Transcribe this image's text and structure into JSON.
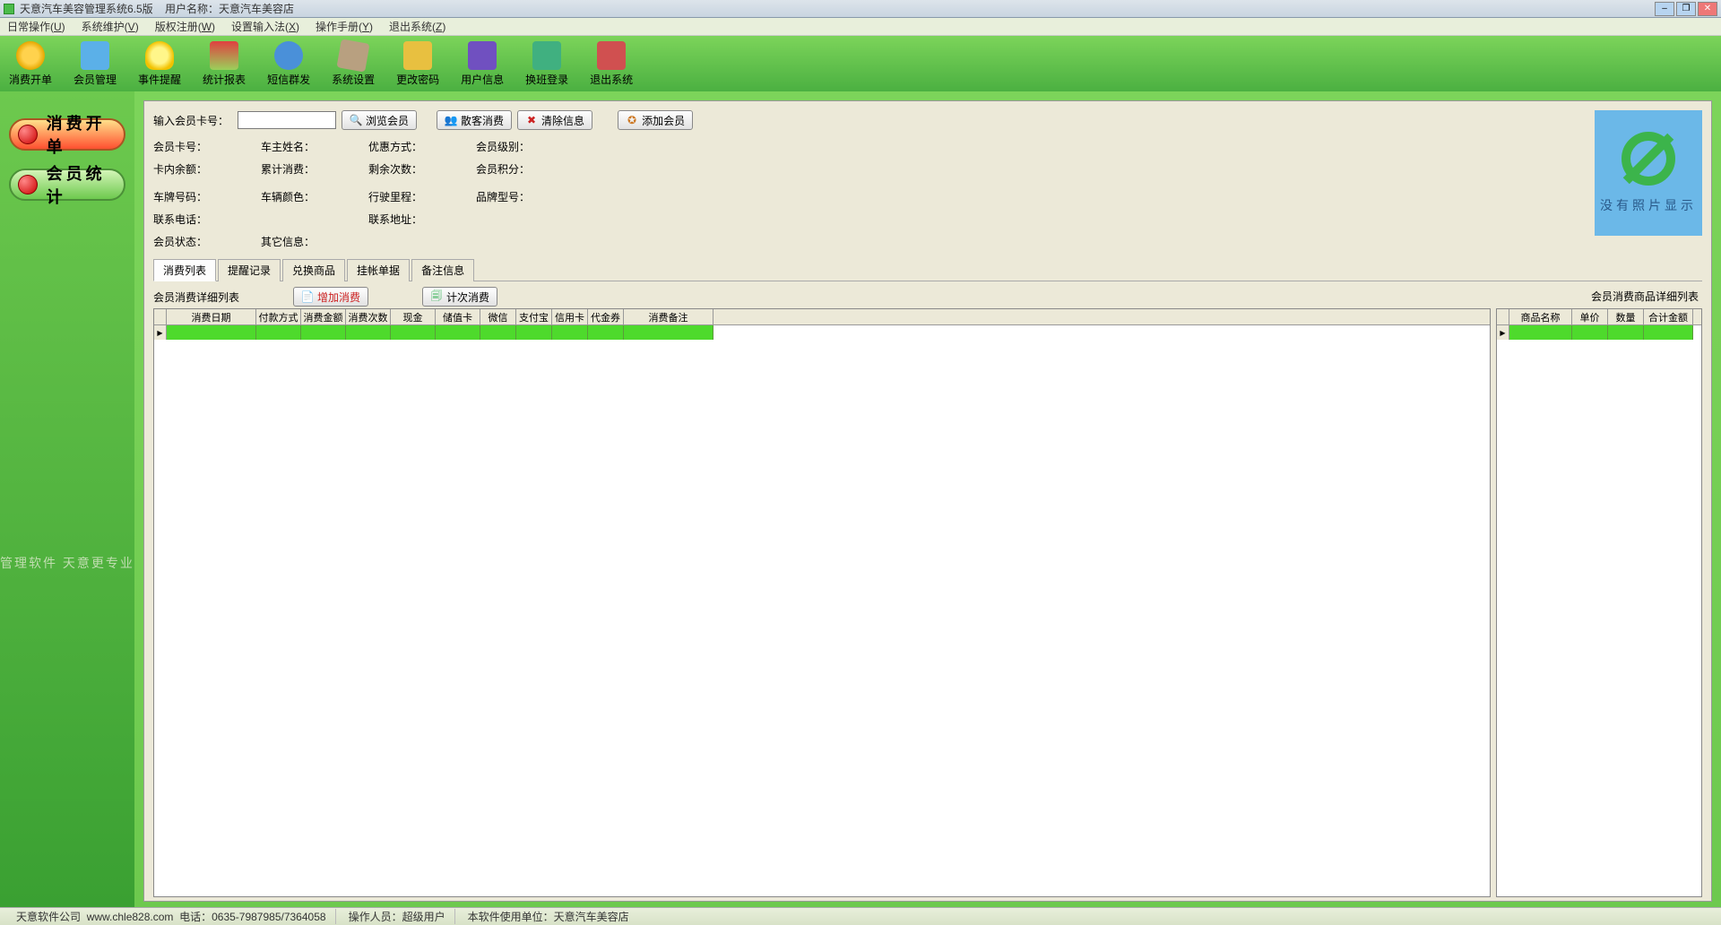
{
  "title": {
    "app": "天意汽车美容管理系统6.5版",
    "user_label": "用户名称：",
    "user_name": "天意汽车美容店"
  },
  "menu": [
    {
      "label": "日常操作",
      "key": "U"
    },
    {
      "label": "系统维护",
      "key": "V"
    },
    {
      "label": "版权注册",
      "key": "W"
    },
    {
      "label": "设置输入法",
      "key": "X"
    },
    {
      "label": "操作手册",
      "key": "Y"
    },
    {
      "label": "退出系统",
      "key": "Z"
    }
  ],
  "toolbar": [
    {
      "label": "消费开单",
      "icon": "coins"
    },
    {
      "label": "会员管理",
      "icon": "people"
    },
    {
      "label": "事件提醒",
      "icon": "bulb"
    },
    {
      "label": "统计报表",
      "icon": "chart"
    },
    {
      "label": "短信群发",
      "icon": "sms"
    },
    {
      "label": "系统设置",
      "icon": "settings"
    },
    {
      "label": "更改密码",
      "icon": "key"
    },
    {
      "label": "用户信息",
      "icon": "user"
    },
    {
      "label": "换班登录",
      "icon": "swap"
    },
    {
      "label": "退出系统",
      "icon": "exit"
    }
  ],
  "sidebar": {
    "btn1": "消费开单",
    "btn2": "会员统计",
    "slogan": "管理软件 天意更专业"
  },
  "search": {
    "label": "输入会员卡号：",
    "btn_browse": "浏览会员",
    "btn_guest": "散客消费",
    "btn_clear": "清除信息",
    "btn_add": "添加会员"
  },
  "info": {
    "r1c1": "会员卡号：",
    "r1c2": "车主姓名：",
    "r1c3": "优惠方式：",
    "r1c4": "会员级别：",
    "r2c1": "卡内余额：",
    "r2c2": "累计消费：",
    "r2c3": "剩余次数：",
    "r2c4": "会员积分：",
    "r3c1": "车牌号码：",
    "r3c2": "车辆颜色：",
    "r3c3": "行驶里程：",
    "r3c4": "品牌型号：",
    "r4c1": "联系电话：",
    "r4c2": "",
    "r4c3": "联系地址：",
    "r4c4": "",
    "r5c1": "会员状态：",
    "r5c2": "其它信息："
  },
  "photo": {
    "no_text": "没有照片显示"
  },
  "tabs": [
    "消费列表",
    "提醒记录",
    "兑换商品",
    "挂帐单据",
    "备注信息"
  ],
  "list": {
    "title_left": "会员消费详细列表",
    "title_right": "会员消费商品详细列表",
    "btn_add": "增加消费",
    "btn_count": "计次消费"
  },
  "cols_left": [
    "消费日期",
    "付款方式",
    "消费金额",
    "消费次数",
    "现金",
    "储值卡",
    "微信",
    "支付宝",
    "信用卡",
    "代金券",
    "消费备注"
  ],
  "cols_left_w": [
    100,
    50,
    50,
    50,
    50,
    50,
    40,
    40,
    40,
    40,
    100
  ],
  "cols_right": [
    "商品名称",
    "单价",
    "数量",
    "合计金额"
  ],
  "cols_right_w": [
    70,
    40,
    40,
    55
  ],
  "status": {
    "company": "天意软件公司",
    "url": "www.chle828.com",
    "tel_label": "电话：",
    "tel": "0635-7987985/7364058",
    "op_label": "操作人员：",
    "op": "超级用户",
    "unit_label": "本软件使用单位：",
    "unit": "天意汽车美容店"
  }
}
